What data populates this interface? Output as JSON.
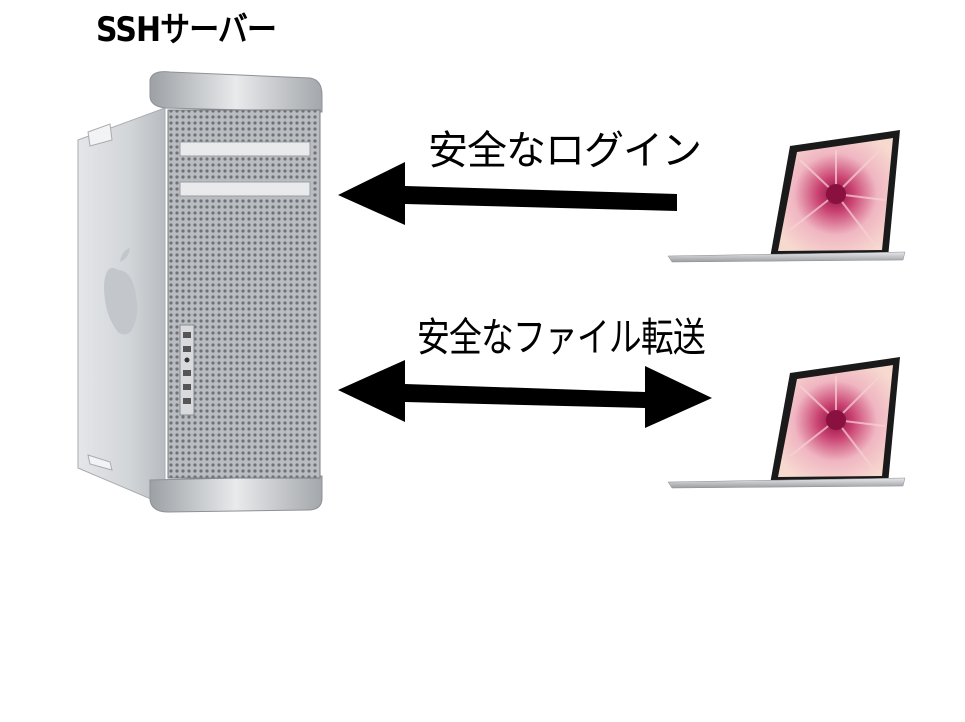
{
  "title": "SSHサーバー",
  "connections": [
    {
      "label": "安全なログイン",
      "direction": "to-server"
    },
    {
      "label": "安全なファイル転送",
      "direction": "bidirectional"
    }
  ],
  "colors": {
    "arrow": "#000000",
    "server_body": "#c9ccd0",
    "mesh": "#8f9296",
    "laptop_screen_bg": "#1a1a1a",
    "flower_petal": "#e8a0b0",
    "flower_center": "#a01850"
  },
  "icons": {
    "server": "mac-pro-tower-icon",
    "client": "laptop-icon"
  }
}
